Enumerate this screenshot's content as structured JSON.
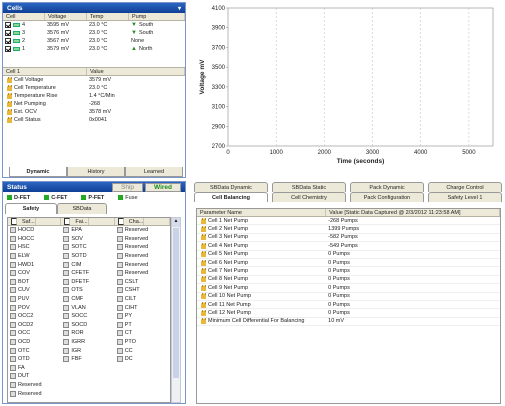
{
  "cells_panel": {
    "title": "Cells",
    "headers": [
      "Cell",
      "Voltage",
      "Temp",
      "Pump"
    ],
    "rows": [
      {
        "num": "4",
        "voltage": "3595 mV",
        "temp": "23.0 °C",
        "pump": "South"
      },
      {
        "num": "3",
        "voltage": "3576 mV",
        "temp": "23.0 °C",
        "pump": "South"
      },
      {
        "num": "2",
        "voltage": "3567 mV",
        "temp": "23.0 °C",
        "pump": "None"
      },
      {
        "num": "1",
        "voltage": "3579 mV",
        "temp": "23.0 °C",
        "pump": "North"
      }
    ]
  },
  "cell_detail": {
    "headers": [
      "Cell 1",
      "Value"
    ],
    "rows": [
      {
        "name": "Cell Voltage",
        "value": "3579 mV"
      },
      {
        "name": "Cell Temperature",
        "value": "23.0 °C"
      },
      {
        "name": "Temperature Rise",
        "value": "1.4 °C/Min"
      },
      {
        "name": "Net Pumping",
        "value": "-268"
      },
      {
        "name": "Est. OCV",
        "value": "3578 mV"
      },
      {
        "name": "Cell Status",
        "value": "0x0041"
      }
    ],
    "tabs": [
      "Dynamic",
      "History",
      "Learned"
    ]
  },
  "chart_data": {
    "type": "line",
    "ylabel": "Voltage mV",
    "xlabel": "Time (seconds)",
    "yticks": [
      "4100",
      "3900",
      "3700",
      "3500",
      "3300",
      "3100",
      "2900",
      "2700"
    ],
    "xticks": [
      "0",
      "1000",
      "2000",
      "3000",
      "4000",
      "5000"
    ],
    "ylim": [
      2700,
      4100
    ],
    "xlim": [
      0,
      5500
    ],
    "series": []
  },
  "status_panel": {
    "title": "Status",
    "ship_btn": "Ship",
    "wired_btn": "Wired",
    "fets": [
      {
        "label": "D-FET",
        "color": "#22aa22"
      },
      {
        "label": "C-FET",
        "color": "#22aa22"
      },
      {
        "label": "P-FET",
        "color": "#22aa22"
      },
      {
        "label": "Fuse",
        "color": "#22aa22"
      }
    ],
    "tabs": [
      "Safety",
      "SBData"
    ],
    "headers": [
      "Saf...",
      "Fai...",
      "Cha..."
    ],
    "col1": [
      "HOCD",
      "HOCC",
      "HSC",
      "ELW",
      "HWD1",
      "COV",
      "BOT",
      "CUV",
      "PUV",
      "POV",
      "OCC2",
      "OCD2",
      "OCC",
      "OCD",
      "OTC",
      "OTD",
      "FA",
      "DUT",
      "Reserved",
      "Reserved"
    ],
    "col2": [
      "EPA",
      "SOV",
      "SOTC",
      "SOTD",
      "CIM",
      "CFETF",
      "DFETF",
      "OTS",
      "CMF",
      "VLAN",
      "SOCC",
      "SOCD",
      "ROR",
      "IGRR",
      "IGR",
      "FBF"
    ],
    "col3": [
      "Reserved",
      "Reserved",
      "Reserved",
      "Reserved",
      "Reserved",
      "Reserved",
      "CSLT",
      "CSHT",
      "CILT",
      "CIHT",
      "PY",
      "PT",
      "CT",
      "PTO",
      "CC",
      "DC"
    ]
  },
  "right_panel": {
    "tabs_top": [
      "SBData Dynamic",
      "SBData Static",
      "Pack Dynamic",
      "Charge Control"
    ],
    "tabs_bottom": [
      "Cell Balancing",
      "Cell Chemistry",
      "Pack Configuration",
      "Safety Level 1"
    ],
    "headers": [
      "Parameter Name",
      "Value [Static Data Captured @ 2/3/2012 11:23:58 AM]"
    ],
    "rows": [
      {
        "name": "Cell 1 Net Pump",
        "value": "-268 Pumps"
      },
      {
        "name": "Cell 2 Net Pump",
        "value": "1399 Pumps"
      },
      {
        "name": "Cell 3 Net Pump",
        "value": "-582 Pumps"
      },
      {
        "name": "Cell 4 Net Pump",
        "value": "-549 Pumps"
      },
      {
        "name": "Cell 5 Net Pump",
        "value": "0 Pumps"
      },
      {
        "name": "Cell 6 Net Pump",
        "value": "0 Pumps"
      },
      {
        "name": "Cell 7 Net Pump",
        "value": "0 Pumps"
      },
      {
        "name": "Cell 8 Net Pump",
        "value": "0 Pumps"
      },
      {
        "name": "Cell 9 Net Pump",
        "value": "0 Pumps"
      },
      {
        "name": "Cell 10 Net Pump",
        "value": "0 Pumps"
      },
      {
        "name": "Cell 11 Net Pump",
        "value": "0 Pumps"
      },
      {
        "name": "Cell 12 Net Pump",
        "value": "0 Pumps"
      },
      {
        "name": "Minimum Cell Differential For Balancing",
        "value": "10 mV"
      }
    ]
  }
}
